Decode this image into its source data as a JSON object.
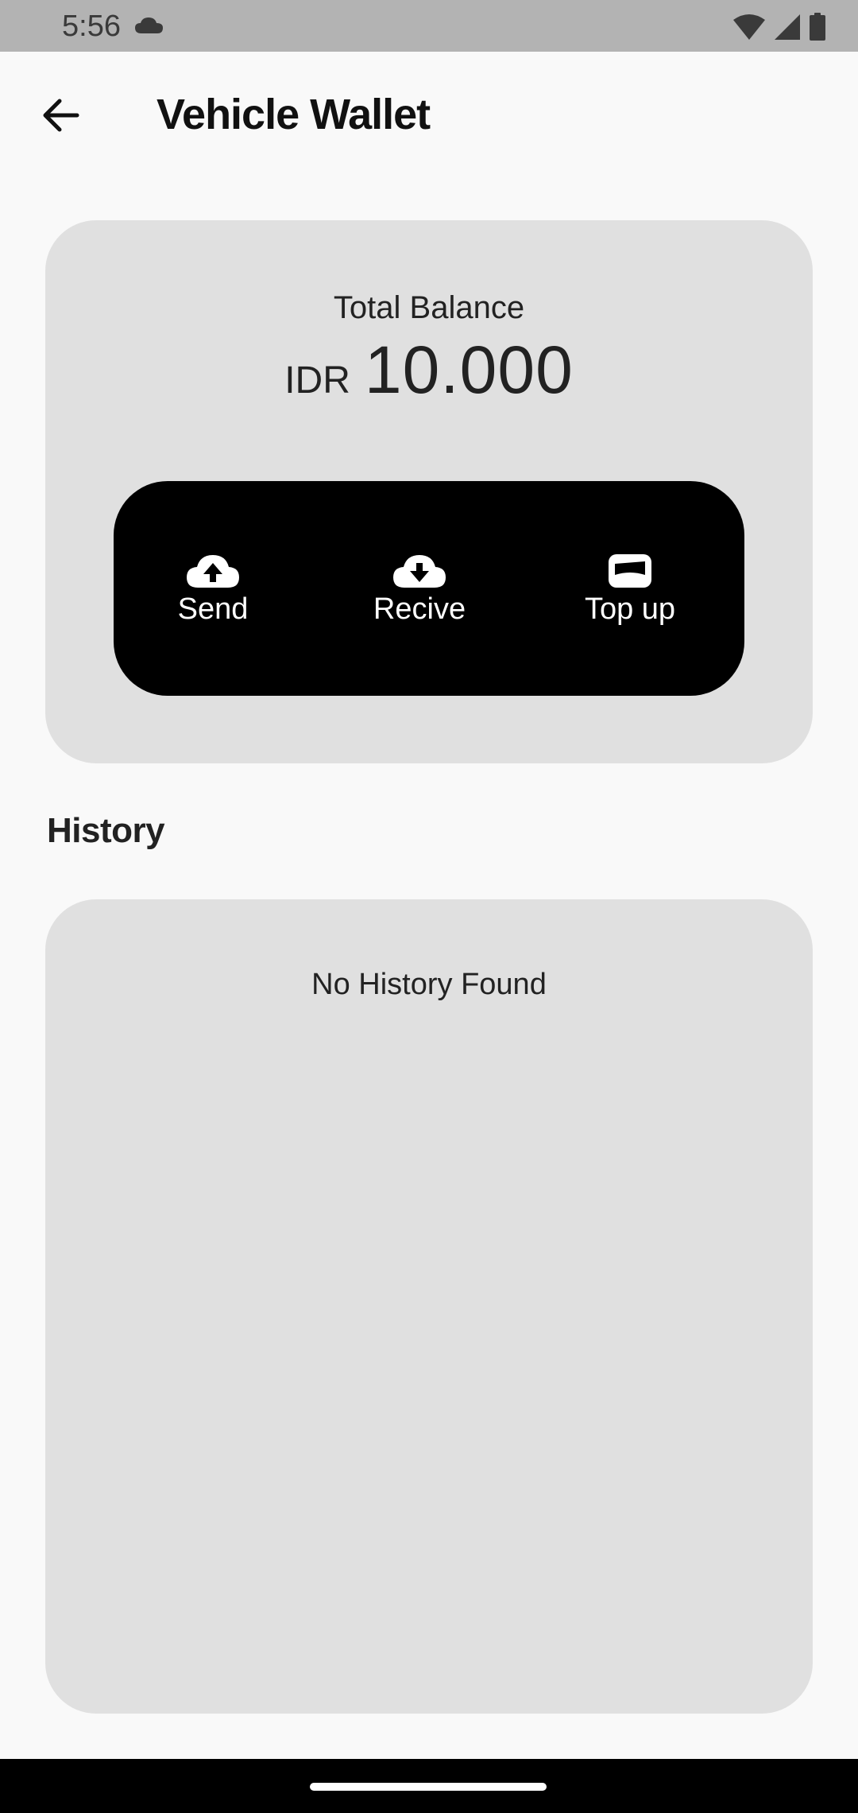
{
  "status_bar": {
    "time": "5:56",
    "icons": [
      "cloud-icon",
      "wifi-icon",
      "signal-icon",
      "battery-icon"
    ]
  },
  "header": {
    "back_icon": "arrow-left-icon",
    "title": "Vehicle Wallet"
  },
  "balance": {
    "label": "Total Balance",
    "currency": "IDR",
    "amount": "10.000"
  },
  "actions": [
    {
      "label": "Send",
      "icon": "cloud-upload-icon"
    },
    {
      "label": "Recive",
      "icon": "cloud-download-icon"
    },
    {
      "label": "Top up",
      "icon": "wallet-icon"
    }
  ],
  "history": {
    "title": "History",
    "empty_text": "No History Found"
  },
  "colors": {
    "background": "#f9f9f9",
    "card": "#e0e0e0",
    "action_panel": "#000000",
    "status_bar": "#b3b3b3"
  }
}
